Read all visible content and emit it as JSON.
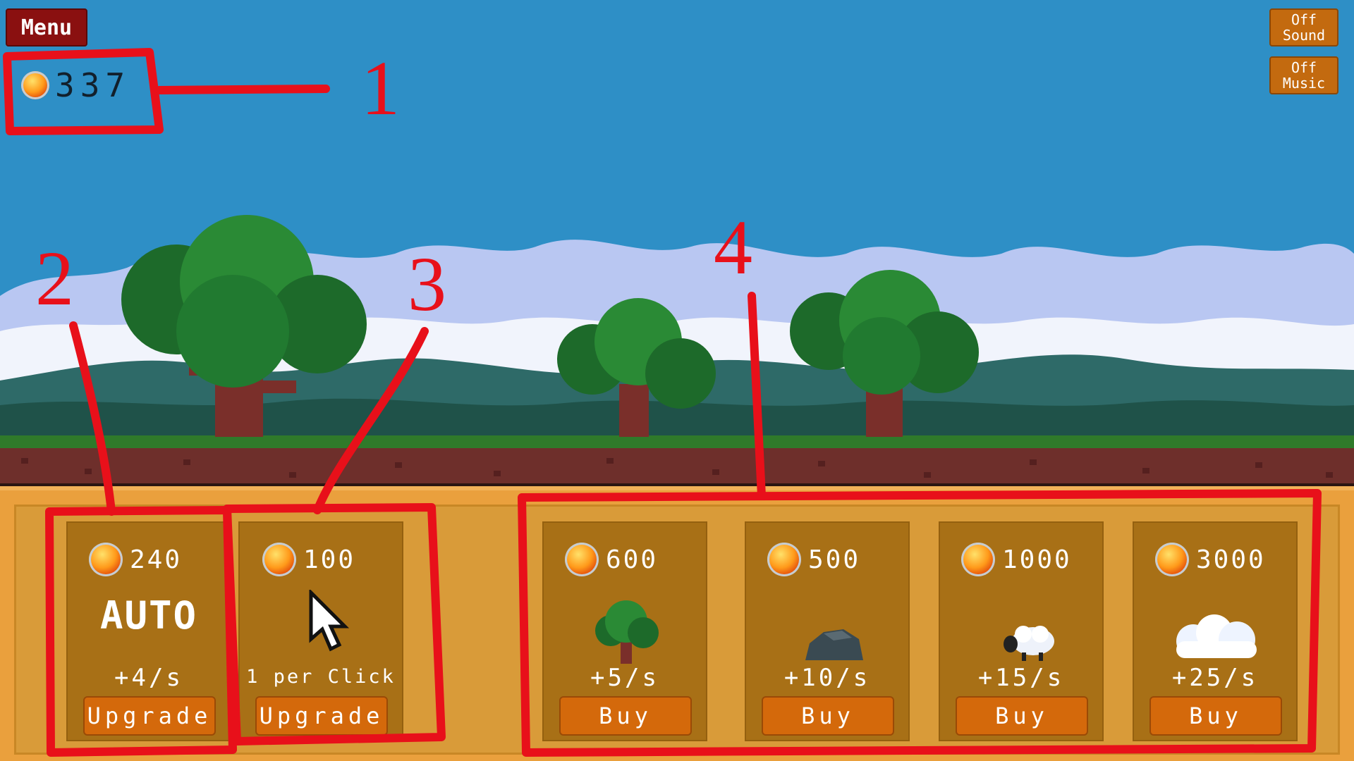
{
  "menu": {
    "label": "Menu"
  },
  "coins": {
    "total": "337"
  },
  "toggles": [
    {
      "state": "Off",
      "name": "Sound"
    },
    {
      "state": "Off",
      "name": "Music"
    }
  ],
  "upgrades": [
    {
      "price": "240",
      "title": "AUTO",
      "rate": "+4/s",
      "button": "Upgrade"
    },
    {
      "price": "100",
      "rate": "1 per Click",
      "button": "Upgrade"
    }
  ],
  "items": [
    {
      "price": "600",
      "icon": "tree-icon",
      "rate": "+5/s",
      "button": "Buy"
    },
    {
      "price": "500",
      "icon": "rock-icon",
      "rate": "+10/s",
      "button": "Buy"
    },
    {
      "price": "1000",
      "icon": "sheep-icon",
      "rate": "+15/s",
      "button": "Buy"
    },
    {
      "price": "3000",
      "icon": "cloud-icon",
      "rate": "+25/s",
      "button": "Buy"
    }
  ],
  "annotations": [
    "1",
    "2",
    "3",
    "4"
  ],
  "colors": {
    "sky": "#2e8fc6",
    "annotation": "#e8101a",
    "shop": "#eaa03d",
    "card": "#a87016",
    "button": "#d4690b"
  }
}
